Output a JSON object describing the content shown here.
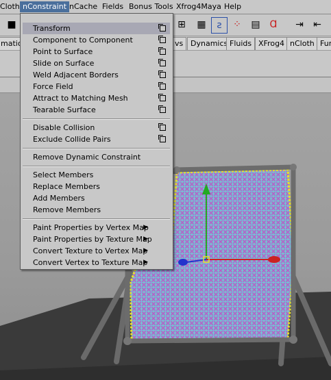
{
  "menubar": {
    "items": [
      "Cloth",
      "nConstraint",
      "nCache",
      "Fields",
      "Bonus Tools",
      "Xfrog4Maya",
      "Help"
    ],
    "active": "nConstraint"
  },
  "shelf_tabs": [
    "mation",
    "vs",
    "Dynamics",
    "Fluids",
    "XFrog4",
    "nCloth",
    "Fur"
  ],
  "menu": {
    "group1": [
      {
        "label": "Transform",
        "option": true
      },
      {
        "label": "Component to Component",
        "option": true
      },
      {
        "label": "Point to Surface",
        "option": true
      },
      {
        "label": "Slide on Surface",
        "option": true
      },
      {
        "label": "Weld Adjacent Borders",
        "option": true
      },
      {
        "label": "Force Field",
        "option": true
      },
      {
        "label": "Attract to Matching Mesh",
        "option": true
      },
      {
        "label": "Tearable Surface",
        "option": true
      }
    ],
    "group2": [
      {
        "label": "Disable Collision",
        "option": true
      },
      {
        "label": "Exclude Collide Pairs",
        "option": true
      }
    ],
    "group3": [
      {
        "label": "Remove Dynamic Constraint"
      }
    ],
    "group4": [
      {
        "label": "Select Members"
      },
      {
        "label": "Replace Members"
      },
      {
        "label": "Add Members"
      },
      {
        "label": "Remove Members"
      }
    ],
    "group5": [
      {
        "label": "Paint Properties by Vertex Map",
        "submenu": true
      },
      {
        "label": "Paint Properties by Texture Map",
        "submenu": true
      },
      {
        "label": "Convert Texture to Vertex Map",
        "submenu": true
      },
      {
        "label": "Convert Vertex to Texture Map",
        "submenu": true
      }
    ],
    "highlighted": "Transform"
  },
  "colors": {
    "menubar_active": "#4a6f9c",
    "menu_highlight": "#a8a8b4",
    "cloth_fill": "#7f9fc8",
    "manip_y": "#22aa22",
    "manip_x": "#cc2222",
    "manip_z": "#2233cc"
  }
}
